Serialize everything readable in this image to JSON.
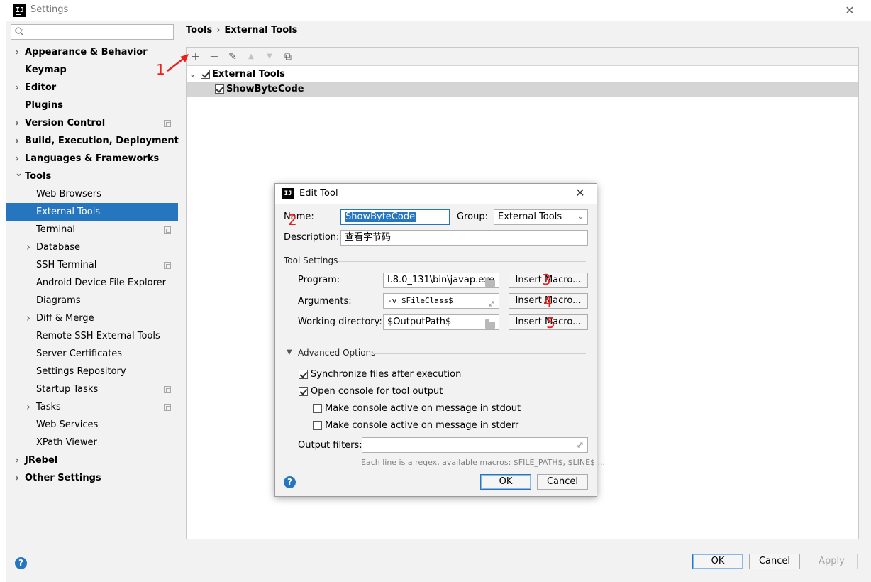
{
  "window": {
    "title": "Settings",
    "app_icon": "IJ"
  },
  "search": {
    "placeholder": "",
    "icon": "search-icon"
  },
  "sidebar": {
    "items": [
      {
        "label": "Appearance & Behavior",
        "bold": true,
        "expandable": true,
        "expanded": false
      },
      {
        "label": "Keymap",
        "bold": true
      },
      {
        "label": "Editor",
        "bold": true,
        "expandable": true,
        "expanded": false
      },
      {
        "label": "Plugins",
        "bold": true
      },
      {
        "label": "Version Control",
        "bold": true,
        "expandable": true,
        "expanded": false,
        "project_icon": true
      },
      {
        "label": "Build, Execution, Deployment",
        "bold": true,
        "expandable": true,
        "expanded": false
      },
      {
        "label": "Languages & Frameworks",
        "bold": true,
        "expandable": true,
        "expanded": false
      },
      {
        "label": "Tools",
        "bold": true,
        "expandable": true,
        "expanded": true
      },
      {
        "label": "Web Browsers",
        "child": true
      },
      {
        "label": "External Tools",
        "child": true,
        "selected": true
      },
      {
        "label": "Terminal",
        "child": true,
        "project_icon": true
      },
      {
        "label": "Database",
        "child": true,
        "expandable": true,
        "expanded": false
      },
      {
        "label": "SSH Terminal",
        "child": true,
        "project_icon": true
      },
      {
        "label": "Android Device File Explorer",
        "child": true
      },
      {
        "label": "Diagrams",
        "child": true
      },
      {
        "label": "Diff & Merge",
        "child": true,
        "expandable": true,
        "expanded": false
      },
      {
        "label": "Remote SSH External Tools",
        "child": true
      },
      {
        "label": "Server Certificates",
        "child": true
      },
      {
        "label": "Settings Repository",
        "child": true
      },
      {
        "label": "Startup Tasks",
        "child": true,
        "project_icon": true
      },
      {
        "label": "Tasks",
        "child": true,
        "expandable": true,
        "expanded": false,
        "project_icon": true
      },
      {
        "label": "Web Services",
        "child": true
      },
      {
        "label": "XPath Viewer",
        "child": true
      },
      {
        "label": "JRebel",
        "bold": true,
        "expandable": true,
        "expanded": false
      },
      {
        "label": "Other Settings",
        "bold": true,
        "expandable": true,
        "expanded": false
      }
    ]
  },
  "breadcrumb": {
    "parent": "Tools",
    "separator": "›",
    "current": "External Tools"
  },
  "toolbar": {
    "add": "+",
    "remove": "−",
    "edit": "✎",
    "move_up": "▲",
    "move_down": "▼",
    "copy": "⧉"
  },
  "tools_tree": {
    "group": {
      "label": "External Tools",
      "checked": true
    },
    "tool": {
      "label": "ShowByteCode",
      "checked": true
    }
  },
  "annotations": [
    "1",
    "2",
    "3",
    "4",
    "5"
  ],
  "dialog": {
    "title": "Edit Tool",
    "name_label": "Name:",
    "name_value": "ShowByteCode",
    "group_label": "Group:",
    "group_value": "External Tools",
    "description_label": "Description:",
    "description_value": "查看字节码",
    "tool_settings_title": "Tool Settings",
    "program_label": "Program:",
    "program_value": "l.8.0_131\\bin\\javap.exe",
    "arguments_label": "Arguments:",
    "arguments_value": "-v $FileClass$",
    "working_dir_label": "Working directory:",
    "working_dir_value": "$OutputPath$",
    "insert_macro_label": "Insert Macro...",
    "advanced_title": "Advanced Options",
    "sync_files_label": "Synchronize files after execution",
    "sync_files_checked": true,
    "open_console_label": "Open console for tool output",
    "open_console_checked": true,
    "stdout_label": "Make console active on message in stdout",
    "stdout_checked": false,
    "stderr_label": "Make console active on message in stderr",
    "stderr_checked": false,
    "output_filters_label": "Output filters:",
    "output_filters_value": "",
    "hint": "Each line is a regex, available macros: $FILE_PATH$, $LINE$ ...",
    "help": "?",
    "ok_label": "OK",
    "cancel_label": "Cancel"
  },
  "footer": {
    "help": "?",
    "ok_label": "OK",
    "cancel_label": "Cancel",
    "apply_label": "Apply"
  },
  "colors": {
    "accent": "#2675bf",
    "annotation": "#e8211f",
    "selection_row": "#d5d5d5"
  }
}
